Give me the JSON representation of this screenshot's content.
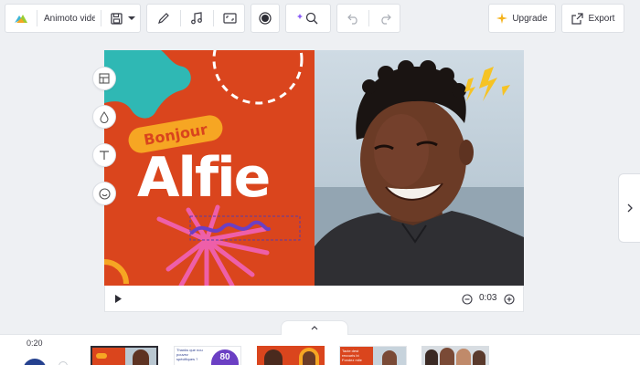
{
  "toolbar": {
    "project_title": "Animoto vide",
    "upgrade_label": "Upgrade",
    "export_label": "Export",
    "icons": [
      "logo-icon",
      "save-icon",
      "chevron-down-icon",
      "pen-icon",
      "music-icon",
      "screen-icon",
      "record-icon",
      "magic-search-icon",
      "undo-icon",
      "redo-icon",
      "sparkle-icon",
      "export-icon"
    ]
  },
  "stage": {
    "greeting": "Bonjour",
    "name": "Alfie",
    "colors": {
      "orange": "#da451d",
      "yellow": "#f6a623",
      "teal": "#2fb8b4",
      "pink": "#ee5fa9",
      "purple": "#6b3fc4"
    }
  },
  "player": {
    "time": "0:03"
  },
  "timeline": {
    "duration": "0:20",
    "thumbnails": [
      {
        "lines": []
      },
      {
        "lines": [
          "Thanks que nou",
          "pouvez",
          "spécifiques ?"
        ],
        "number": "80"
      },
      {
        "lines": []
      },
      {
        "lines": [
          "Tacte dest",
          "recouris bi",
          "Fondez mile"
        ]
      },
      {
        "lines": []
      }
    ]
  }
}
